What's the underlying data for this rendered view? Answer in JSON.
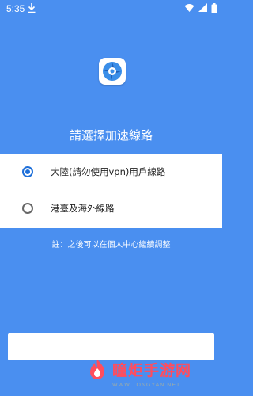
{
  "status_bar": {
    "time": "5:35",
    "icons": [
      "download-icon",
      "wifi-icon",
      "cell-signal-icon",
      "battery-icon"
    ]
  },
  "app": {
    "logo_icon": "app-logo-icon"
  },
  "dialog": {
    "title": "請選擇加速線路",
    "options": [
      {
        "label": "大陸(請勿使用vpn)用戶線路",
        "selected": true
      },
      {
        "label": "港臺及海外線路",
        "selected": false
      }
    ],
    "note": "註：之後可以在個人中心繼續調整"
  },
  "watermark": {
    "brand": "瞳炬手游网",
    "url": "WWW.TONGYAN.NET"
  },
  "colors": {
    "background": "#4a8ff0",
    "radio_accent": "#1e6fd9",
    "watermark_red": "#ff4d5e"
  }
}
